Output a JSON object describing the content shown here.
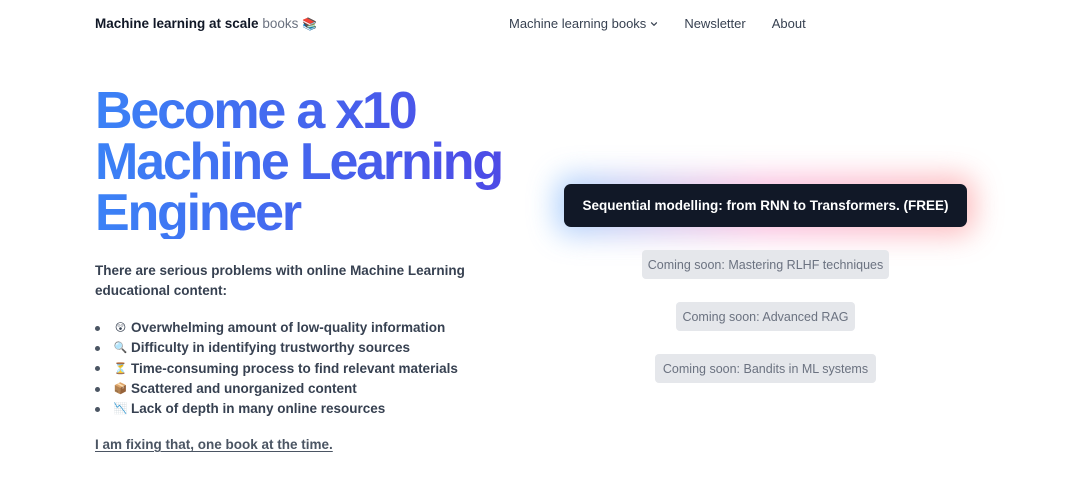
{
  "header": {
    "brand_strong": "Machine learning at scale",
    "brand_light": "books",
    "brand_emoji": "📚",
    "nav": [
      {
        "label": "Machine learning books",
        "icon": "chevron-down-icon",
        "has_dropdown": true
      },
      {
        "label": "Newsletter"
      },
      {
        "label": "About"
      }
    ]
  },
  "hero": {
    "title_lines": [
      "Become a x10",
      "Machine Learning",
      "Engineer"
    ],
    "title_gradient": [
      "#3b82f6",
      "#4f46e5"
    ],
    "intro": "There are serious problems with online Machine Learning educational content:",
    "problems": [
      {
        "emoji": "😲",
        "icon": "astonished-face-icon",
        "text": "Overwhelming amount of low-quality information"
      },
      {
        "emoji": "🔍",
        "icon": "magnifying-glass-icon",
        "text": "Difficulty in identifying trustworthy sources"
      },
      {
        "emoji": "⏳",
        "icon": "hourglass-icon",
        "text": "Time-consuming process to find relevant materials"
      },
      {
        "emoji": "📦",
        "icon": "package-icon",
        "text": "Scattered and unorganized content"
      },
      {
        "emoji": "📉",
        "icon": "chart-decreasing-icon",
        "text": "Lack of depth in many online resources"
      }
    ],
    "fix_link": "I am fixing that, one book at the time."
  },
  "books": {
    "featured": "Sequential modelling: from RNN to Transformers. (FREE)",
    "coming_soon": [
      "Coming soon: Mastering RLHF techniques",
      "Coming soon: Advanced RAG",
      "Coming soon: Bandits in ML systems"
    ]
  },
  "colors": {
    "featured_bg": "#111827",
    "coming_soon_bg": "#e5e7eb",
    "coming_soon_text": "#6b7280",
    "glow": [
      "#93c5fd",
      "#f9a8d4",
      "#fca5a5"
    ]
  }
}
